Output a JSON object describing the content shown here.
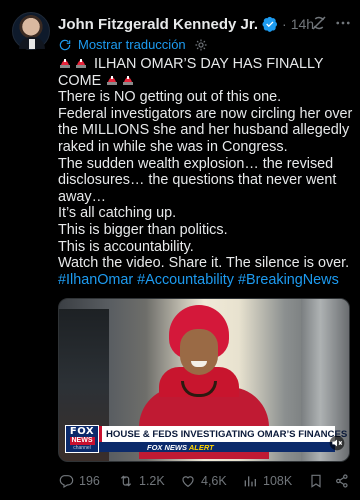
{
  "post": {
    "author_name": "John Fitzgerald Kennedy Jr.",
    "separator": "·",
    "time": "14h",
    "translate_label": "Mostrar traducción",
    "headline_line1": "ILHAN OMAR’S DAY HAS FINALLY",
    "headline_line2": "COME",
    "lines": [
      "There is NO getting out of this one.",
      "Federal investigators are now circling her over",
      "the MILLIONS she and her husband allegedly",
      "raked in while she was in Congress.",
      "The sudden wealth explosion… the revised",
      "disclosures… the questions that never went",
      "away…",
      "It’s all catching up.",
      "This is bigger than politics.",
      "This is accountability.",
      "Watch the video. Share it. The silence is over."
    ],
    "hashtags": "#IlhanOmar #Accountability #BreakingNews"
  },
  "media": {
    "fox_logo": "FOX",
    "fox_news": "NEWS",
    "fox_channel": "channel",
    "chyron": "HOUSE & FEDS INVESTIGATING OMAR’S FINANCES",
    "alert_prefix": "FOX NEWS",
    "alert_word": "ALERT"
  },
  "actions": {
    "replies": "196",
    "reposts": "1.2K",
    "likes": "4,6K",
    "views": "108K"
  },
  "colors": {
    "background": "#000000",
    "text": "#e7e9ea",
    "secondary": "#71767b",
    "link": "#1d9bf0",
    "verified": "#1d9bf0"
  },
  "icons": {
    "verified": "verified-badge-icon",
    "grok": "grok-icon",
    "more": "more-icon",
    "translate": "translate-icon",
    "settings": "settings-icon",
    "siren": "police-light-emoji",
    "mute": "mute-icon",
    "reply": "reply-icon",
    "retweet": "retweet-icon",
    "like": "heart-icon",
    "views": "views-icon",
    "bookmark": "bookmark-icon",
    "share": "share-icon"
  }
}
